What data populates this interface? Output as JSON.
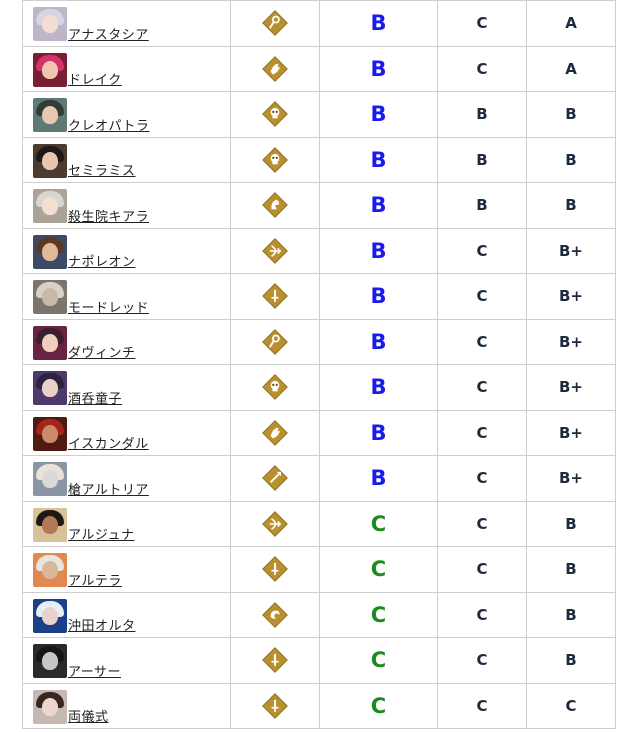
{
  "colors": {
    "grade_b": "#1a1aee",
    "grade_c": "#1e8a1e",
    "text_dark": "#1c2a3c",
    "icon_gold": "#b8902e",
    "border": "#cfcfcf"
  },
  "rows": [
    {
      "name": "アナスタシア",
      "class_icon": "caster-icon",
      "grade1": "B",
      "grade2": "C",
      "grade3": "A",
      "portrait": "portrait-anastasia",
      "hair": "#d8d4e2",
      "face": "#f3dcd0",
      "bg": "#bcb6c8"
    },
    {
      "name": "ドレイク",
      "class_icon": "rider-icon",
      "grade1": "B",
      "grade2": "C",
      "grade3": "A",
      "portrait": "portrait-drake",
      "hair": "#d2336a",
      "face": "#f0c6b0",
      "bg": "#7a1f33"
    },
    {
      "name": "クレオパトラ",
      "class_icon": "assassin-icon",
      "grade1": "B",
      "grade2": "B",
      "grade3": "B",
      "portrait": "portrait-cleopatra",
      "hair": "#2f3e3a",
      "face": "#e8c8b0",
      "bg": "#5f7a73"
    },
    {
      "name": "セミラミス",
      "class_icon": "assassin-icon",
      "grade1": "B",
      "grade2": "B",
      "grade3": "B",
      "portrait": "portrait-semiramis",
      "hair": "#1e1a1a",
      "face": "#e7c6ae",
      "bg": "#4d3b2f"
    },
    {
      "name": "殺生院キアラ",
      "class_icon": "moon-cancer-icon",
      "grade1": "B",
      "grade2": "B",
      "grade3": "B",
      "portrait": "portrait-kiara",
      "hair": "#d9d5d0",
      "face": "#f2dfd2",
      "bg": "#aaa39a"
    },
    {
      "name": "ナポレオン",
      "class_icon": "archer-icon",
      "grade1": "B",
      "grade2": "C",
      "grade3": "B+",
      "portrait": "portrait-napoleon",
      "hair": "#5a3a25",
      "face": "#e2b896",
      "bg": "#3c4a67"
    },
    {
      "name": "モードレッド",
      "class_icon": "saber-icon",
      "grade1": "B",
      "grade2": "C",
      "grade3": "B+",
      "portrait": "portrait-mordred",
      "hair": "#d6d2c9",
      "face": "#c9b9a8",
      "bg": "#7b756c"
    },
    {
      "name": "ダヴィンチ",
      "class_icon": "caster-icon",
      "grade1": "B",
      "grade2": "C",
      "grade3": "B+",
      "portrait": "portrait-davinci",
      "hair": "#3a1f2e",
      "face": "#f0cdbd",
      "bg": "#6a2443"
    },
    {
      "name": "酒呑童子",
      "class_icon": "assassin-icon",
      "grade1": "B",
      "grade2": "C",
      "grade3": "B+",
      "portrait": "portrait-shuten",
      "hair": "#2b2340",
      "face": "#ead0c6",
      "bg": "#4b3a6b"
    },
    {
      "name": "イスカンダル",
      "class_icon": "rider-icon",
      "grade1": "B",
      "grade2": "C",
      "grade3": "B+",
      "portrait": "portrait-iskandar",
      "hair": "#a32618",
      "face": "#c98a6b",
      "bg": "#4e1a12"
    },
    {
      "name": "槍アルトリア",
      "class_icon": "lancer-icon",
      "grade1": "B",
      "grade2": "C",
      "grade3": "B+",
      "portrait": "portrait-artoria-lancer",
      "hair": "#e8e3d6",
      "face": "#dad8da",
      "bg": "#8b95a6"
    },
    {
      "name": "アルジュナ",
      "class_icon": "archer-icon",
      "grade1": "C",
      "grade2": "C",
      "grade3": "B",
      "portrait": "portrait-arjuna",
      "hair": "#201814",
      "face": "#b07a58",
      "bg": "#d9c29a"
    },
    {
      "name": "アルテラ",
      "class_icon": "saber-icon",
      "grade1": "C",
      "grade2": "C",
      "grade3": "B",
      "portrait": "portrait-altera",
      "hair": "#e9e4de",
      "face": "#d8b79a",
      "bg": "#e08a52"
    },
    {
      "name": "沖田オルタ",
      "class_icon": "alter-ego-icon",
      "grade1": "C",
      "grade2": "C",
      "grade3": "B",
      "portrait": "portrait-okita-alter",
      "hair": "#e9eef4",
      "face": "#e7d3cc",
      "bg": "#1c3f8a"
    },
    {
      "name": "アーサー",
      "class_icon": "saber-icon",
      "grade1": "C",
      "grade2": "C",
      "grade3": "B",
      "portrait": "portrait-arthur",
      "hair": "#161616",
      "face": "#c7c7c7",
      "bg": "#2a2a2a"
    },
    {
      "name": "両儀式",
      "class_icon": "saber-icon",
      "grade1": "C",
      "grade2": "C",
      "grade3": "C",
      "portrait": "portrait-ryougi",
      "hair": "#3a2621",
      "face": "#ecd6cc",
      "bg": "#c6b8b3"
    }
  ]
}
